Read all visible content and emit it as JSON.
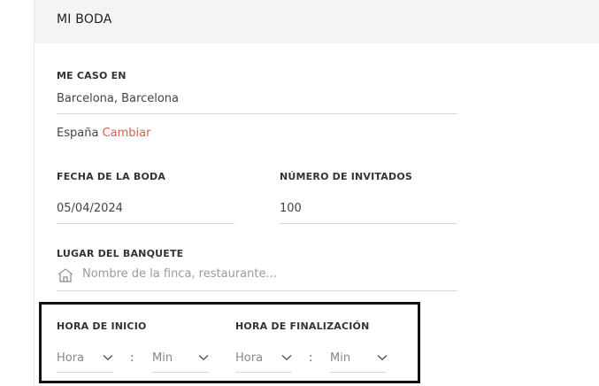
{
  "header": {
    "title": "MI BODA"
  },
  "location": {
    "label": "ME CASO EN",
    "city": "Barcelona, Barcelona",
    "country": "España",
    "change_link": "Cambiar"
  },
  "date": {
    "label": "FECHA DE LA BODA",
    "value": "05/04/2024"
  },
  "guests": {
    "label": "NÚMERO DE INVITADOS",
    "value": "100"
  },
  "venue": {
    "label": "LUGAR DEL BANQUETE",
    "placeholder": "Nombre de la finca, restaurante..."
  },
  "start_time": {
    "label": "HORA DE INICIO",
    "hour": "Hora",
    "separator": ":",
    "minute": "Min"
  },
  "end_time": {
    "label": "HORA DE FINALIZACIÓN",
    "hour": "Hora",
    "separator": ":",
    "minute": "Min"
  },
  "colors": {
    "accent": "#e05a4e",
    "header_bg": "#f4f4f4",
    "highlight_border": "#111111"
  },
  "icons": {
    "venue": "house-icon",
    "dropdown": "chevron-down-icon"
  }
}
